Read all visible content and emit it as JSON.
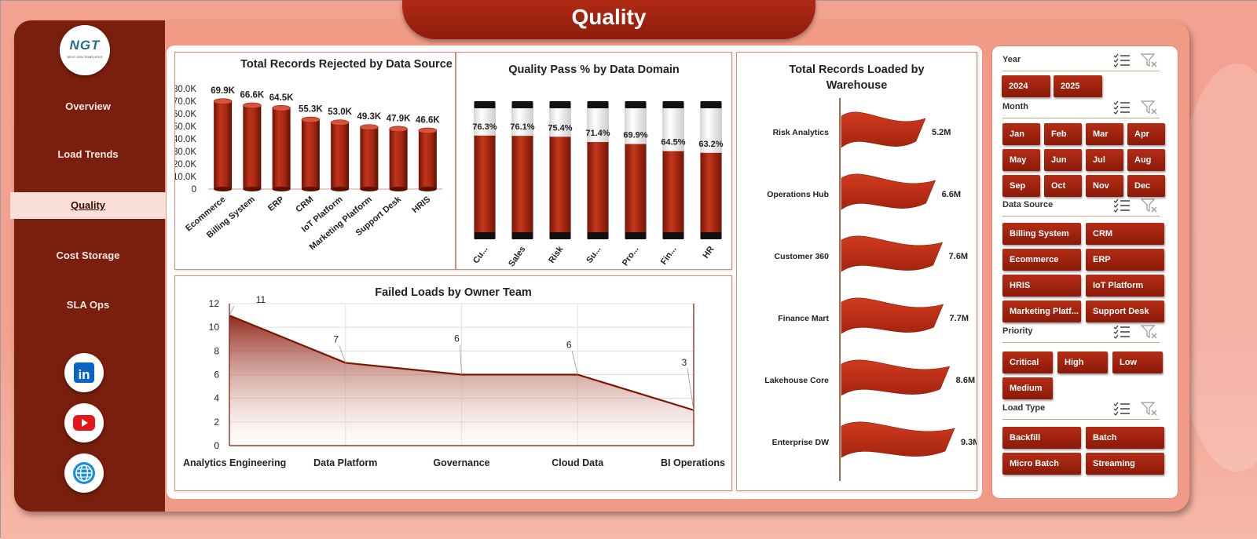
{
  "header": {
    "title": "Quality"
  },
  "logo": {
    "text": "NGT",
    "subtext": "NEXT GEN TEMPLATES"
  },
  "sidebar": {
    "items": [
      {
        "label": "Overview"
      },
      {
        "label": "Load Trends"
      },
      {
        "label": "Quality"
      },
      {
        "label": "Cost Storage"
      },
      {
        "label": "SLA Ops"
      }
    ],
    "active": "Quality"
  },
  "social": [
    {
      "icon": "linkedin-icon"
    },
    {
      "icon": "youtube-icon"
    },
    {
      "icon": "globe-icon"
    }
  ],
  "colors": {
    "accent": "#9e2410",
    "sidebar": "#7a1f0e",
    "bg": "#f19a86"
  },
  "charts": [
    {
      "id": "rejected",
      "chart_data": {
        "type": "bar",
        "title": "Total Records Rejected by Data Source",
        "categories": [
          "Ecommerce",
          "Billing System",
          "ERP",
          "CRM",
          "IoT Platform",
          "Marketing Platform",
          "Support Desk",
          "HRIS"
        ],
        "values": [
          69900,
          66600,
          64500,
          55300,
          53000,
          49300,
          47900,
          46600
        ],
        "labels": [
          "69.9K",
          "66.6K",
          "64.5K",
          "55.3K",
          "53.0K",
          "49.3K",
          "47.9K",
          "46.6K"
        ],
        "yticks": [
          "80.0K",
          "70.0K",
          "60.0K",
          "50.0K",
          "40.0K",
          "30.0K",
          "20.0K",
          "10.0K",
          "0"
        ],
        "ylim": [
          0,
          80000
        ]
      }
    },
    {
      "id": "passpct",
      "chart_data": {
        "type": "bar",
        "title": "Quality Pass % by Data Domain",
        "categories": [
          "Cu...",
          "Sales",
          "Risk",
          "Su...",
          "Pro...",
          "Fin...",
          "HR"
        ],
        "values": [
          76.3,
          76.1,
          75.4,
          71.4,
          69.9,
          64.5,
          63.2
        ],
        "labels": [
          "76.3%",
          "76.1%",
          "75.4%",
          "71.4%",
          "69.9%",
          "64.5%",
          "63.2%"
        ],
        "ylim": [
          0,
          100
        ]
      }
    },
    {
      "id": "warehouse",
      "chart_data": {
        "type": "bar",
        "title": "Total Records Loaded by Warehouse",
        "categories": [
          "Risk Analytics",
          "Operations Hub",
          "Customer 360",
          "Finance Mart",
          "Lakehouse Core",
          "Enterprise DW"
        ],
        "values": [
          5.2,
          6.6,
          7.6,
          7.7,
          8.6,
          9.3
        ],
        "labels": [
          "5.2M",
          "6.6M",
          "7.6M",
          "7.7M",
          "8.6M",
          "9.3M"
        ]
      }
    },
    {
      "id": "failed",
      "chart_data": {
        "type": "area",
        "title": "Failed Loads by Owner Team",
        "categories": [
          "Analytics Engineering",
          "Data Platform",
          "Governance",
          "Cloud Data",
          "BI Operations"
        ],
        "values": [
          11,
          7,
          6,
          6,
          3
        ],
        "yticks": [
          "12",
          "10",
          "8",
          "6",
          "4",
          "2",
          "0"
        ],
        "ylim": [
          0,
          12
        ],
        "grid": true
      }
    }
  ],
  "slicers": {
    "year": {
      "label": "Year",
      "items": [
        "2024",
        "2025"
      ]
    },
    "month": {
      "label": "Month",
      "items": [
        "Jan",
        "Feb",
        "Mar",
        "Apr",
        "May",
        "Jun",
        "Jul",
        "Aug",
        "Sep",
        "Oct",
        "Nov",
        "Dec"
      ]
    },
    "data_source": {
      "label": "Data Source",
      "items": [
        "Billing System",
        "CRM",
        "Ecommerce",
        "ERP",
        "HRIS",
        "IoT Platform",
        "Marketing Platf...",
        "Support Desk"
      ]
    },
    "priority": {
      "label": "Priority",
      "items": [
        "Critical",
        "High",
        "Low",
        "Medium"
      ]
    },
    "load_type": {
      "label": "Load Type",
      "items": [
        "Backfill",
        "Batch",
        "Micro Batch",
        "Streaming"
      ]
    }
  }
}
